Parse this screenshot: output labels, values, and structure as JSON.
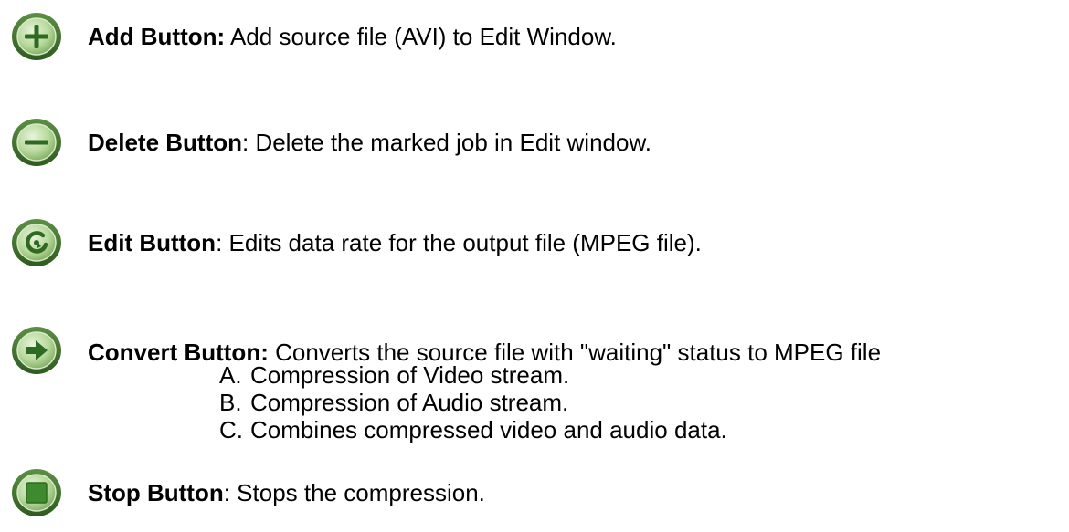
{
  "buttons": [
    {
      "icon": "plus-icon",
      "name": "Add Button:",
      "desc": " Add source file (AVI) to Edit Window."
    },
    {
      "icon": "minus-icon",
      "name": "Delete Button",
      "desc": ": Delete the marked job in Edit window."
    },
    {
      "icon": "edit-icon",
      "name": "Edit Button",
      "desc": ": Edits data rate for the output file (MPEG file)."
    },
    {
      "icon": "arrow-right-icon",
      "name": "Convert Button:",
      "desc": " Converts the source file with \"waiting\" status to MPEG file"
    },
    {
      "icon": "stop-icon",
      "name": "Stop Button",
      "desc": ": Stops the compression."
    }
  ],
  "convert_steps": [
    {
      "letter": "A.",
      "text": "Compression of Video stream."
    },
    {
      "letter": "B.",
      "text": "Compression of Audio stream."
    },
    {
      "letter": "C.",
      "text": "Combines compressed video and audio data."
    }
  ],
  "colors": {
    "icon_green_light": "#a9cf8a",
    "icon_green_dark": "#2f6a22",
    "icon_ring": "#6ea055"
  }
}
